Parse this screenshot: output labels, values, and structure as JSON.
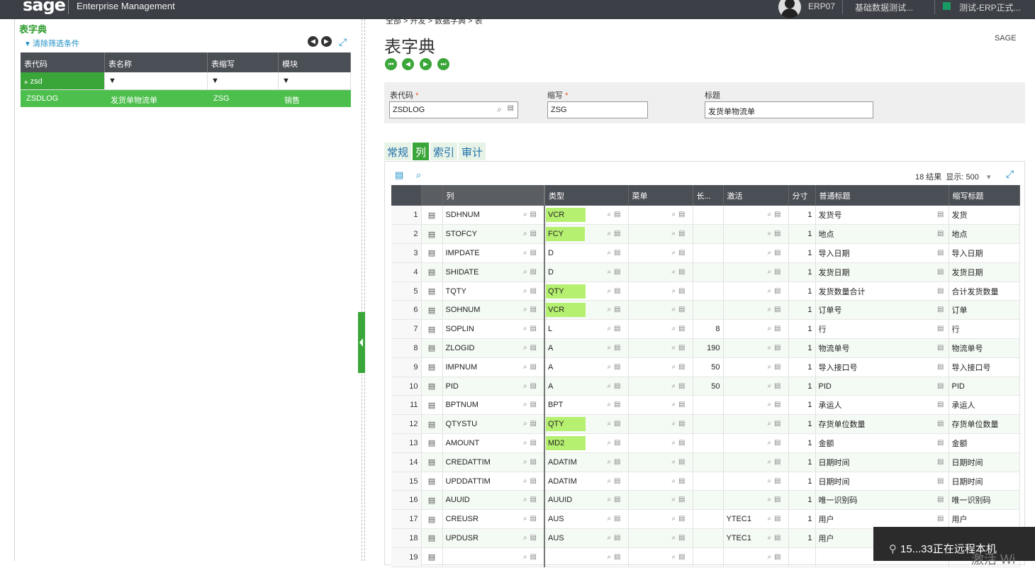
{
  "topbar": {
    "logo": "sage",
    "app_title": "Enterprise Management",
    "user": "ERP07",
    "folder": "基础数据测试...",
    "environment": "测试-ERP正式..."
  },
  "left_panel": {
    "title": "表字典",
    "clear_filter": "清除筛选条件",
    "columns": [
      "表代码",
      "表名称",
      "表缩写",
      "模块"
    ],
    "filter_value": "zsd",
    "rows": [
      {
        "code": "ZSDLOG",
        "name": "发货单物流单",
        "abbr": "ZSG",
        "module": "销售"
      }
    ]
  },
  "main": {
    "breadcrumb": "全部 > 开发 > 数据字典 > 表",
    "title": "表字典",
    "sage_tag": "SAGE",
    "fields": {
      "table_code_label": "表代码",
      "table_code": "ZSDLOG",
      "abbr_label": "缩写",
      "abbr": "ZSG",
      "title_label": "标题",
      "title": "发货单物流单"
    },
    "tabs": [
      "常规",
      "列",
      "索引",
      "审计"
    ],
    "grid": {
      "results": "18 结果",
      "display_label": "显示:",
      "display_value": "500",
      "headers": [
        "列",
        "类型",
        "菜单",
        "长...",
        "激活",
        "分寸",
        "普通标题",
        "缩写标题"
      ],
      "rows": [
        {
          "n": "1",
          "col": "SDHNUM",
          "type": "VCR",
          "hl": true,
          "menu": "",
          "len": "",
          "act": "",
          "dim": "1",
          "title": "发货号",
          "short": "发货"
        },
        {
          "n": "2",
          "col": "STOFCY",
          "type": "FCY",
          "hl": true,
          "menu": "",
          "len": "",
          "act": "",
          "dim": "1",
          "title": "地点",
          "short": "地点"
        },
        {
          "n": "3",
          "col": "IMPDATE",
          "type": "D",
          "hl": false,
          "menu": "",
          "len": "",
          "act": "",
          "dim": "1",
          "title": "导入日期",
          "short": "导入日期"
        },
        {
          "n": "4",
          "col": "SHIDATE",
          "type": "D",
          "hl": false,
          "menu": "",
          "len": "",
          "act": "",
          "dim": "1",
          "title": "发货日期",
          "short": "发货日期"
        },
        {
          "n": "5",
          "col": "TQTY",
          "type": "QTY",
          "hl": true,
          "menu": "",
          "len": "",
          "act": "",
          "dim": "1",
          "title": "发货数量合计",
          "short": "合计发货数量"
        },
        {
          "n": "6",
          "col": "SOHNUM",
          "type": "VCR",
          "hl": true,
          "menu": "",
          "len": "",
          "act": "",
          "dim": "1",
          "title": "订单号",
          "short": "订单"
        },
        {
          "n": "7",
          "col": "SOPLIN",
          "type": "L",
          "hl": false,
          "menu": "",
          "len": "8",
          "act": "",
          "dim": "1",
          "title": "行",
          "short": "行"
        },
        {
          "n": "8",
          "col": "ZLOGID",
          "type": "A",
          "hl": false,
          "menu": "",
          "len": "190",
          "act": "",
          "dim": "1",
          "title": "物流单号",
          "short": "物流单号"
        },
        {
          "n": "9",
          "col": "IMPNUM",
          "type": "A",
          "hl": false,
          "menu": "",
          "len": "50",
          "act": "",
          "dim": "1",
          "title": "导入接口号",
          "short": "导入接口号"
        },
        {
          "n": "10",
          "col": "PID",
          "type": "A",
          "hl": false,
          "menu": "",
          "len": "50",
          "act": "",
          "dim": "1",
          "title": "PID",
          "short": "PID"
        },
        {
          "n": "11",
          "col": "BPTNUM",
          "type": "BPT",
          "hl": false,
          "menu": "",
          "len": "",
          "act": "",
          "dim": "1",
          "title": "承运人",
          "short": "承运人"
        },
        {
          "n": "12",
          "col": "QTYSTU",
          "type": "QTY",
          "hl": true,
          "menu": "",
          "len": "",
          "act": "",
          "dim": "1",
          "title": "存货单位数量",
          "short": "存货单位数量"
        },
        {
          "n": "13",
          "col": "AMOUNT",
          "type": "MD2",
          "hl": true,
          "menu": "",
          "len": "",
          "act": "",
          "dim": "1",
          "title": "金额",
          "short": "金额"
        },
        {
          "n": "14",
          "col": "CREDATTIM",
          "type": "ADATIM",
          "hl": false,
          "menu": "",
          "len": "",
          "act": "",
          "dim": "1",
          "title": "日期时间",
          "short": "日期时间"
        },
        {
          "n": "15",
          "col": "UPDDATTIM",
          "type": "ADATIM",
          "hl": false,
          "menu": "",
          "len": "",
          "act": "",
          "dim": "1",
          "title": "日期时间",
          "short": "日期时间"
        },
        {
          "n": "16",
          "col": "AUUID",
          "type": "AUUID",
          "hl": false,
          "menu": "",
          "len": "",
          "act": "",
          "dim": "1",
          "title": "唯一识别码",
          "short": "唯一识别码"
        },
        {
          "n": "17",
          "col": "CREUSR",
          "type": "AUS",
          "hl": false,
          "menu": "",
          "len": "",
          "act": "YTEC1",
          "dim": "1",
          "title": "用户",
          "short": "用户"
        },
        {
          "n": "18",
          "col": "UPDUSR",
          "type": "AUS",
          "hl": false,
          "menu": "",
          "len": "",
          "act": "YTEC1",
          "dim": "1",
          "title": "用户",
          "short": "用户"
        },
        {
          "n": "19",
          "col": "",
          "type": "",
          "hl": false,
          "menu": "",
          "len": "",
          "act": "",
          "dim": "",
          "title": "",
          "short": ""
        }
      ]
    }
  },
  "toast": {
    "text": "15...33正在远程本机"
  },
  "watermark": "激活 Wi"
}
